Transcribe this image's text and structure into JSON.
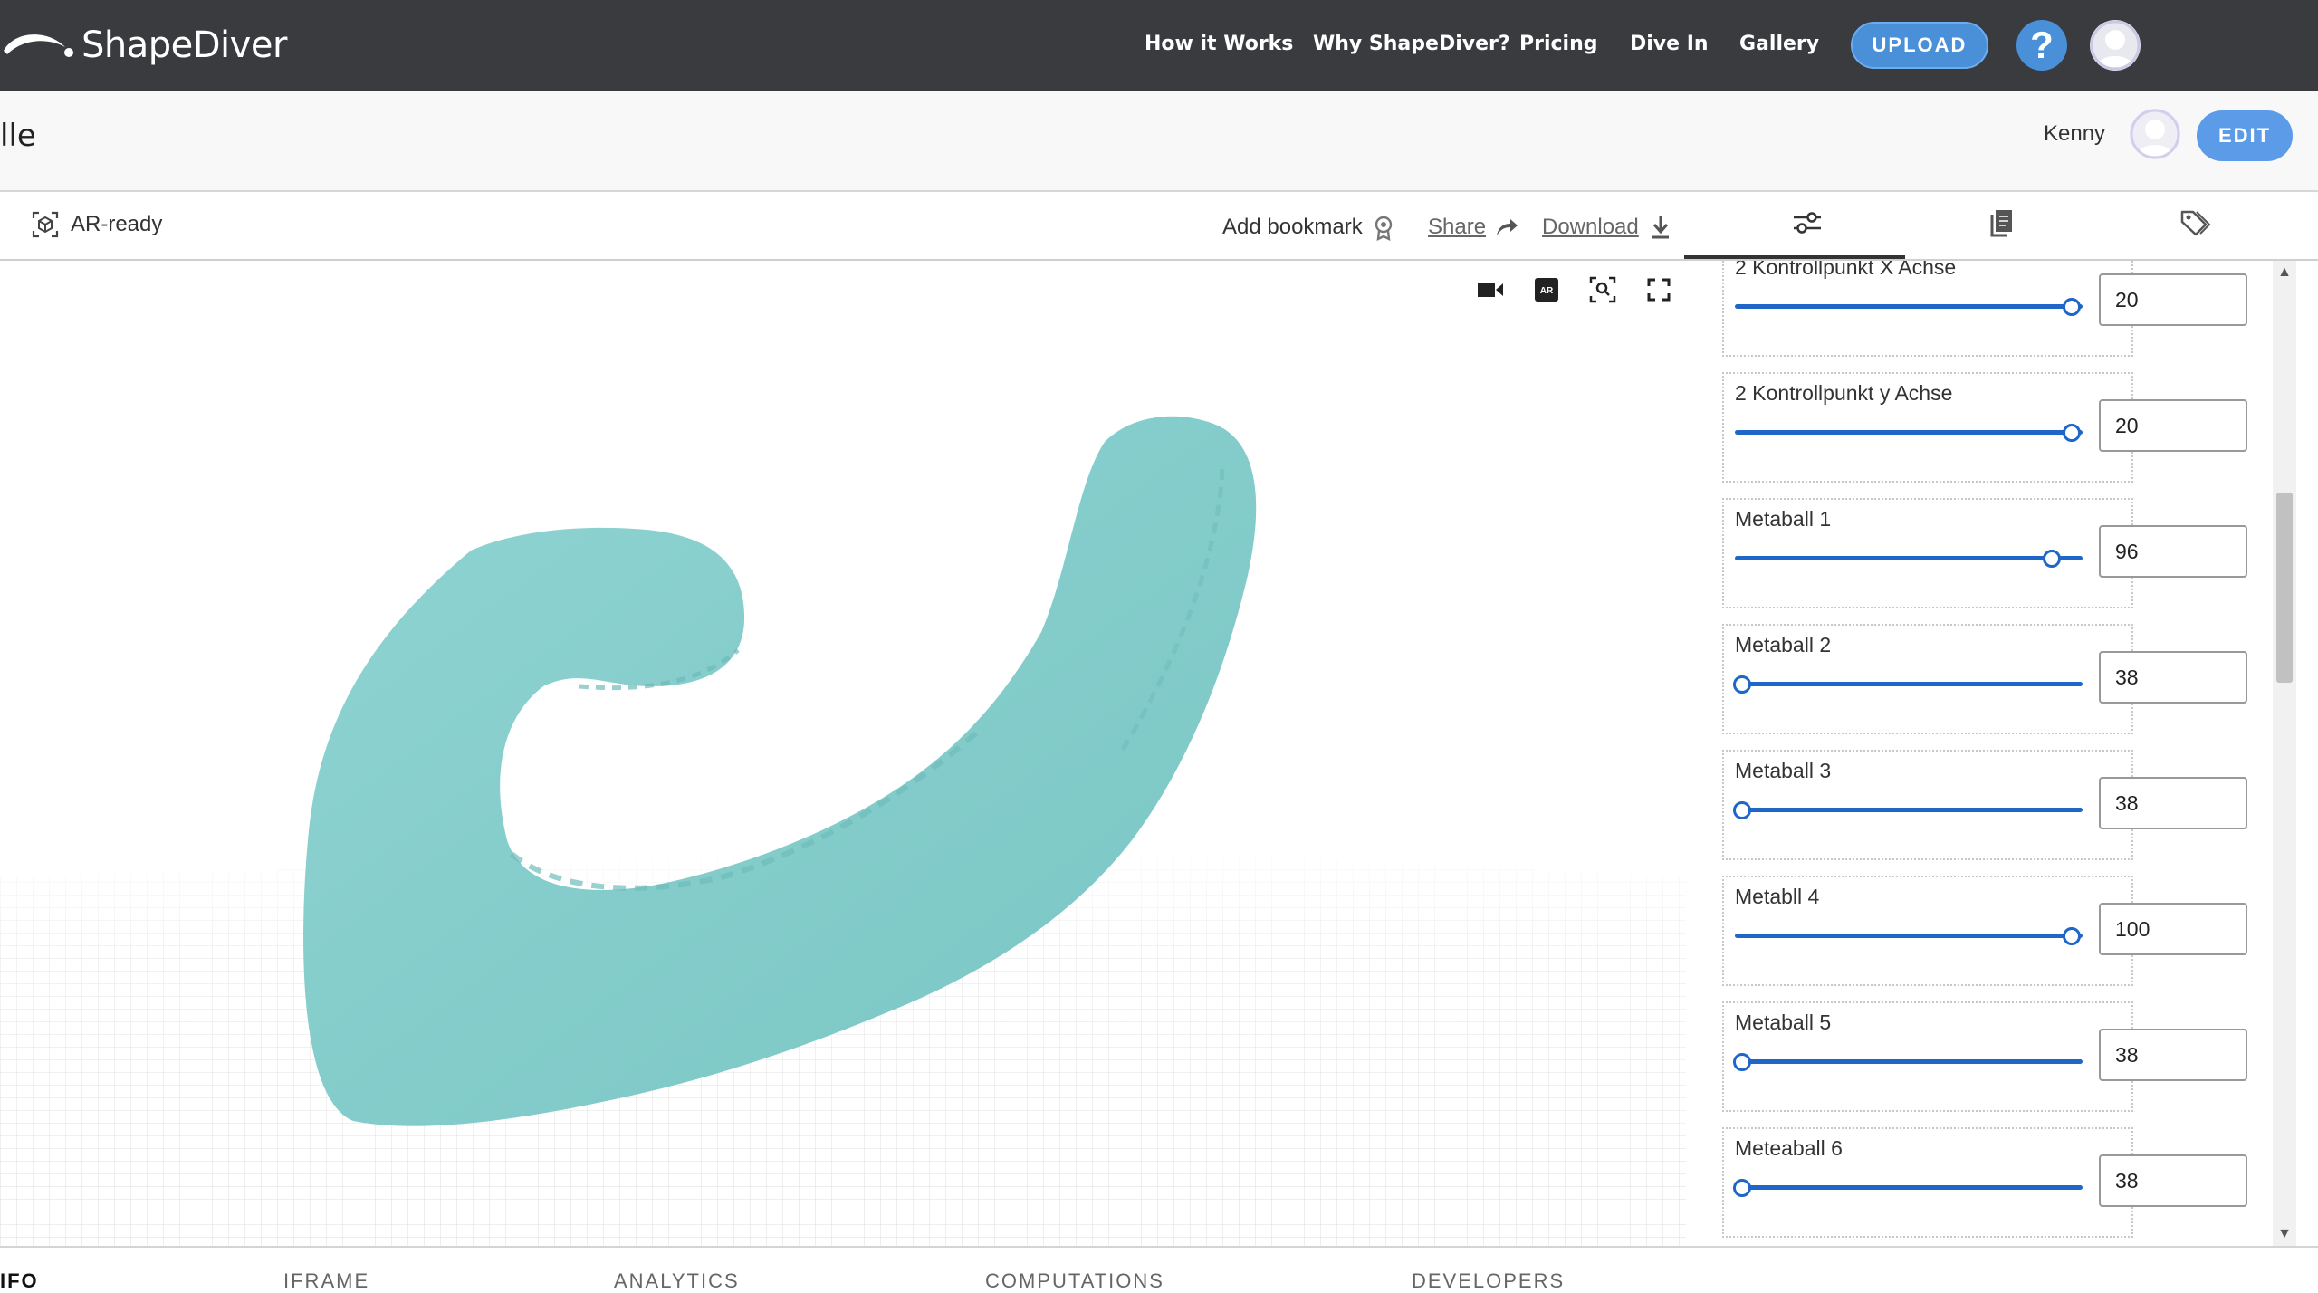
{
  "brand": {
    "name": "ShapeDiver"
  },
  "nav": {
    "links": [
      "How it Works",
      "Why ShapeDiver?",
      "Pricing",
      "Dive In",
      "Gallery"
    ],
    "upload_label": "UPLOAD",
    "help_symbol": "?"
  },
  "titlebar": {
    "title": "lle",
    "owner": "Kenny",
    "edit_label": "EDIT"
  },
  "toolbar": {
    "ar_ready": "AR-ready",
    "add_bookmark": "Add bookmark",
    "share": "Share",
    "download": "Download",
    "tabs": [
      "sliders-icon",
      "copy-icon",
      "tags-icon"
    ]
  },
  "viewer": {
    "controls": [
      "camera-icon",
      "ar-icon",
      "zoom-extents-icon",
      "fullscreen-icon"
    ],
    "model_color": "#82cccb"
  },
  "params": [
    {
      "label": "2 Kontrollpunkt X Achse",
      "value": "20",
      "fraction": 1.0
    },
    {
      "label": "2 Kontrollpunkt y Achse",
      "value": "20",
      "fraction": 1.0
    },
    {
      "label": "Metaball 1",
      "value": "96",
      "fraction": 0.94
    },
    {
      "label": "Metaball 2",
      "value": "38",
      "fraction": 0.0
    },
    {
      "label": "Metaball 3",
      "value": "38",
      "fraction": 0.0
    },
    {
      "label": "Metabll 4",
      "value": "100",
      "fraction": 1.0
    },
    {
      "label": "Metaball 5",
      "value": "38",
      "fraction": 0.0
    },
    {
      "label": "Meteaball 6",
      "value": "38",
      "fraction": 0.0
    }
  ],
  "bottom_tabs": [
    "IFO",
    "IFRAME",
    "ANALYTICS",
    "COMPUTATIONS",
    "DEVELOPERS"
  ],
  "colors": {
    "nav_bg": "#3a3b3f",
    "accent": "#4a90d9",
    "slider": "#1e66c8"
  }
}
